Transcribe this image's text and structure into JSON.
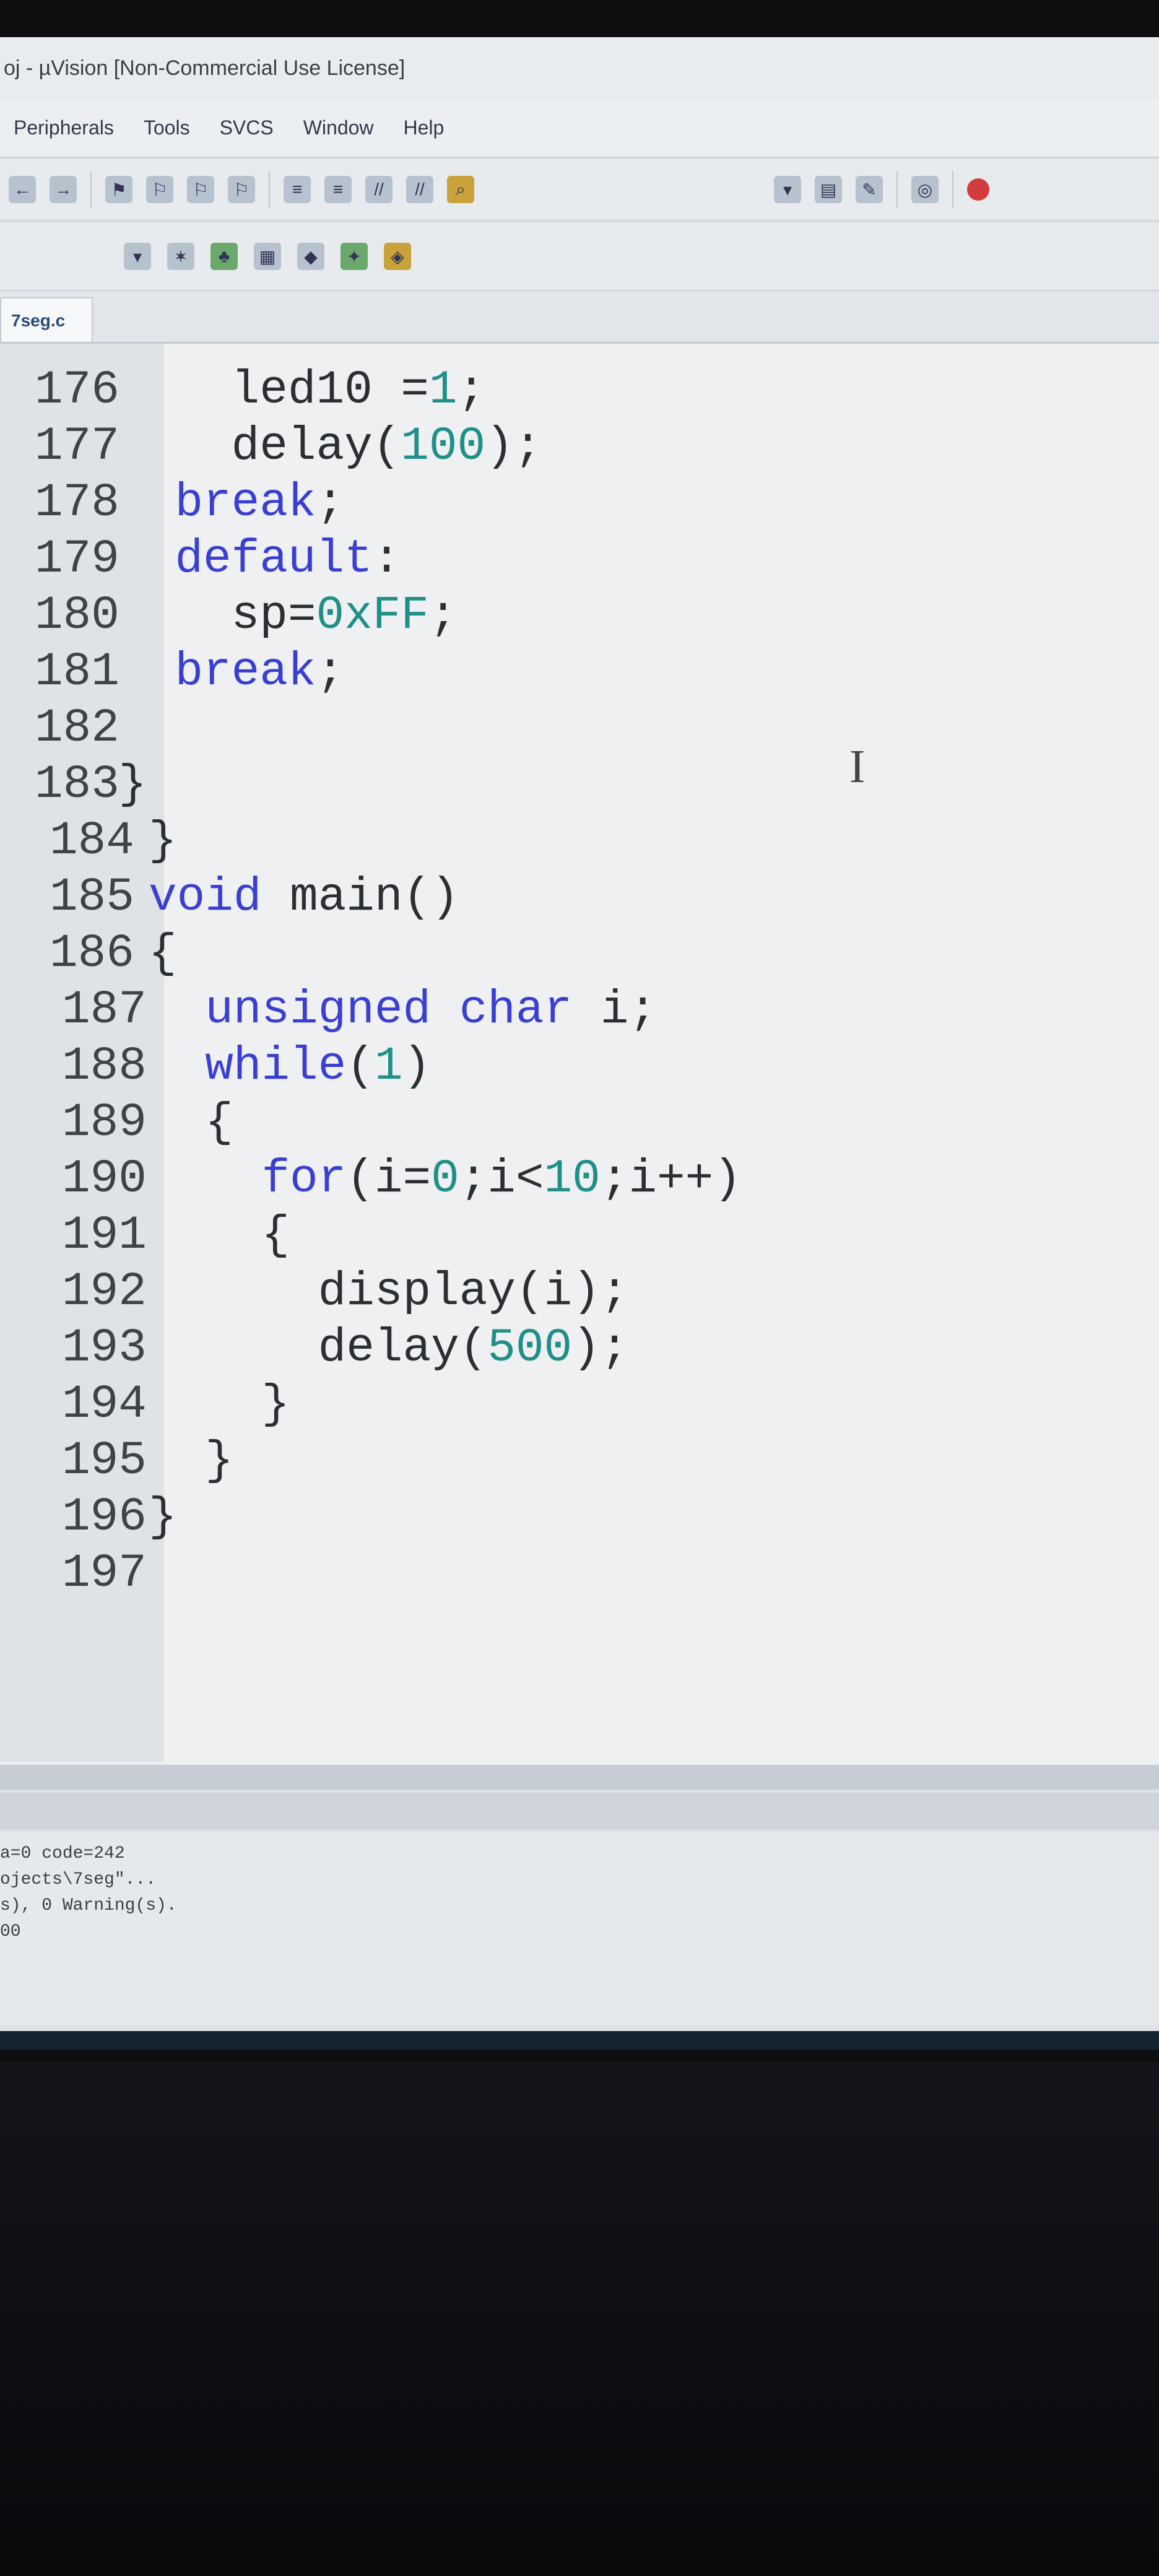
{
  "window": {
    "title": "oj - µVision  [Non-Commercial Use License]"
  },
  "menu": [
    "Peripherals",
    "Tools",
    "SVCS",
    "Window",
    "Help"
  ],
  "editor": {
    "tab_label": "7seg.c",
    "lines": [
      {
        "num": "176",
        "code": "      led10 =1;"
      },
      {
        "num": "177",
        "code": "      delay(100);"
      },
      {
        "num": "178",
        "code": "    break;"
      },
      {
        "num": "179",
        "code": "    default:"
      },
      {
        "num": "180",
        "code": "      sp=0xFF;"
      },
      {
        "num": "181",
        "code": "    break;"
      },
      {
        "num": "182",
        "code": ""
      },
      {
        "num": "183",
        "code": "  }"
      },
      {
        "num": "184",
        "code": "}"
      },
      {
        "num": "185",
        "code": "void main()"
      },
      {
        "num": "186",
        "code": "{"
      },
      {
        "num": "187",
        "code": "  unsigned char i;"
      },
      {
        "num": "188",
        "code": "  while(1)"
      },
      {
        "num": "189",
        "code": "  {"
      },
      {
        "num": "190",
        "code": "    for(i=0;i<10;i++)"
      },
      {
        "num": "191",
        "code": "    {"
      },
      {
        "num": "192",
        "code": "      display(i);"
      },
      {
        "num": "193",
        "code": "      delay(500);"
      },
      {
        "num": "194",
        "code": "    }"
      },
      {
        "num": "195",
        "code": "  }"
      },
      {
        "num": "196",
        "code": "}"
      },
      {
        "num": "197",
        "code": ""
      }
    ]
  },
  "output": {
    "lines": [
      "a=0 code=242",
      "ojects\\7seg\"...",
      "s), 0 Warning(s).",
      "00"
    ]
  },
  "taskbar": {
    "icons": [
      "minus-icon",
      "file-explorer-icon",
      "chrome-icon",
      "keil-icon",
      "app-icon"
    ]
  },
  "colors": {
    "keyword": "#3a3fd2",
    "number": "#1f8f88",
    "text": "#2b2f33",
    "editor_bg": "#eef0f1"
  }
}
